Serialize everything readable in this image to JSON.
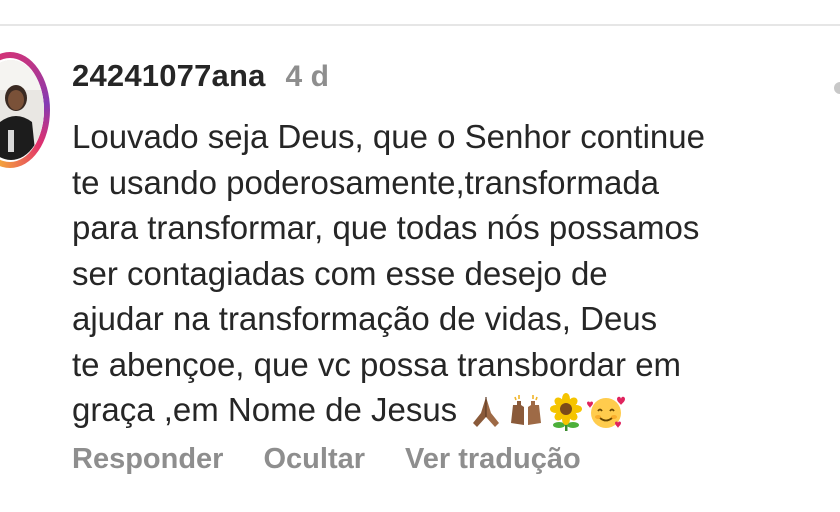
{
  "comment": {
    "username": "24241077ana",
    "timestamp": "4 d",
    "text_lines": [
      "Louvado seja Deus, que o Senhor continue",
      "te usando poderosamente,transformada",
      "para transformar, que todas nós possamos",
      "ser contagiadas com esse desejo de",
      "ajudar na transformação de vidas, Deus",
      "te abençoe, que vc possa transbordar em",
      "graça ,em Nome de Jesus"
    ],
    "emojis": [
      "folded-hands-icon",
      "raising-hands-icon",
      "sunflower-icon",
      "smiling-face-with-hearts-icon"
    ]
  },
  "actions": {
    "reply_label": "Responder",
    "hide_label": "Ocultar",
    "translate_label": "Ver tradução"
  },
  "colors": {
    "text": "#262626",
    "muted": "#8e8e8e",
    "divider": "#e6e6e6"
  }
}
